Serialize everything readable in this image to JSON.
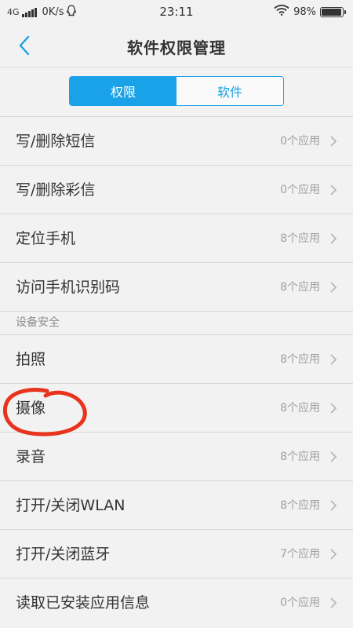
{
  "status_bar": {
    "network": "4G",
    "speed": "0K/s",
    "time": "23:11",
    "battery_percent": "98%",
    "battery_level": 0.98,
    "icons": [
      "signal-icon",
      "qq-icon",
      "wifi-icon",
      "battery-icon"
    ]
  },
  "header": {
    "title": "软件权限管理",
    "back_icon": "back-chevron-icon"
  },
  "tabs": [
    {
      "label": "权限",
      "active": true
    },
    {
      "label": "软件",
      "active": false
    }
  ],
  "rows_group1": [
    {
      "label": "写/删除短信",
      "value": "0个应用"
    },
    {
      "label": "写/删除彩信",
      "value": "0个应用"
    },
    {
      "label": "定位手机",
      "value": "8个应用"
    },
    {
      "label": "访问手机识别码",
      "value": "8个应用"
    }
  ],
  "section_device": {
    "title": "设备安全"
  },
  "rows_group2": [
    {
      "label": "拍照",
      "value": "8个应用"
    },
    {
      "label": "摄像",
      "value": "8个应用"
    },
    {
      "label": "录音",
      "value": "8个应用"
    },
    {
      "label": "打开/关闭WLAN",
      "value": "8个应用"
    },
    {
      "label": "打开/关闭蓝牙",
      "value": "7个应用"
    },
    {
      "label": "读取已安装应用信息",
      "value": "0个应用"
    }
  ],
  "colors": {
    "accent": "#1aa2e8",
    "annotation": "#e8341c",
    "background": "#f2f2f2"
  }
}
